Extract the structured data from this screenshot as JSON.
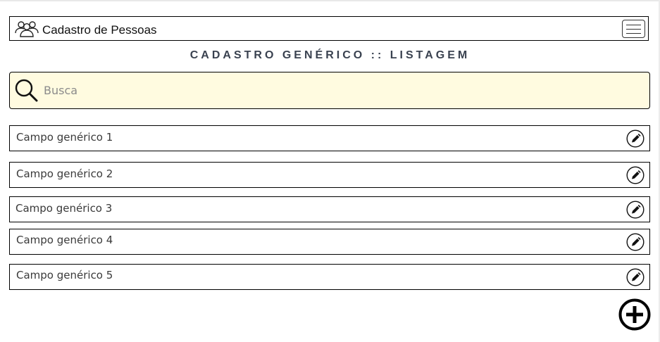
{
  "header": {
    "title": "Cadastro de Pessoas",
    "logo_icon": "people-group-icon",
    "menu_icon": "hamburger-menu-icon"
  },
  "page_title": "CADASTRO GENÉRICO :: LISTAGEM",
  "search": {
    "placeholder": "Busca",
    "value": "",
    "icon": "search-icon",
    "background": "#fffbe0"
  },
  "items": [
    {
      "label": "Campo genérico 1",
      "action_icon": "edit-pencil-icon"
    },
    {
      "label": "Campo genérico 2",
      "action_icon": "edit-pencil-icon"
    },
    {
      "label": "Campo genérico 3",
      "action_icon": "edit-pencil-icon"
    },
    {
      "label": "Campo genérico 4",
      "action_icon": "edit-pencil-icon"
    },
    {
      "label": "Campo genérico 5",
      "action_icon": "edit-pencil-icon"
    }
  ],
  "add_button": {
    "icon": "add-circle-icon"
  }
}
